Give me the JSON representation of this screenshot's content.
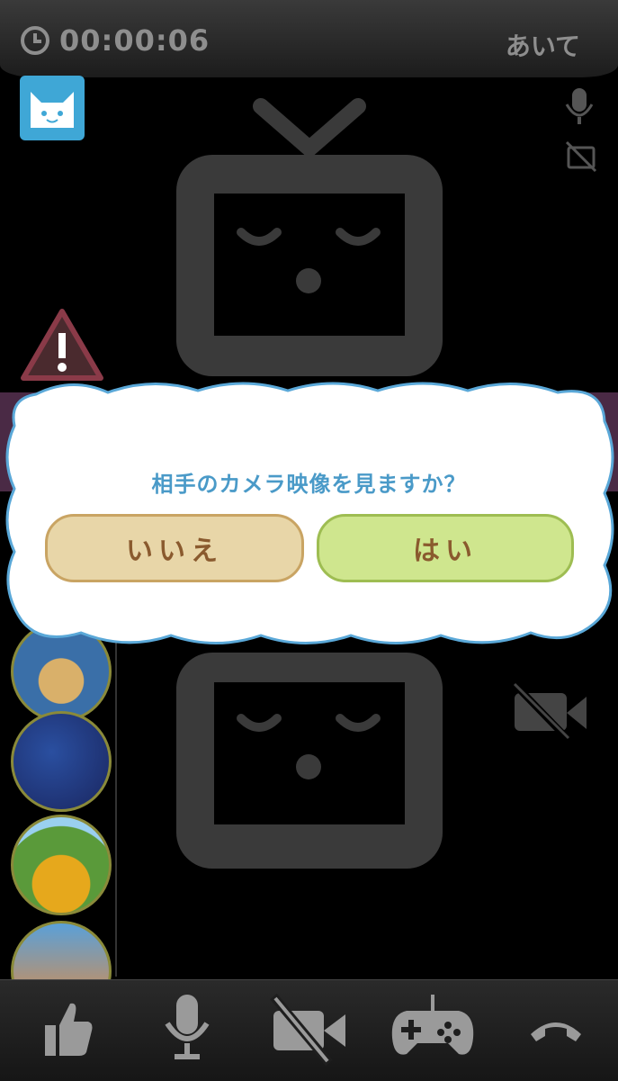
{
  "header": {
    "timer": "00:00:06",
    "partner_label": "あいて"
  },
  "dialog": {
    "message": "相手のカメラ映像を見ますか？",
    "no_label": "いいえ",
    "yes_label": "はい"
  },
  "colors": {
    "dialog_text": "#4a9ac8",
    "no_button": "#e8d6a8",
    "yes_button": "#cfe68e",
    "button_text": "#8a5a2e",
    "avatar_bg": "#3fa7d6"
  },
  "stickers": [
    "picnic",
    "tanabata",
    "sunflowers",
    "bottles"
  ],
  "toolbar": [
    "thumbs-up-icon",
    "microphone-icon",
    "camera-off-icon",
    "gamepad-icon",
    "hang-up-icon"
  ]
}
